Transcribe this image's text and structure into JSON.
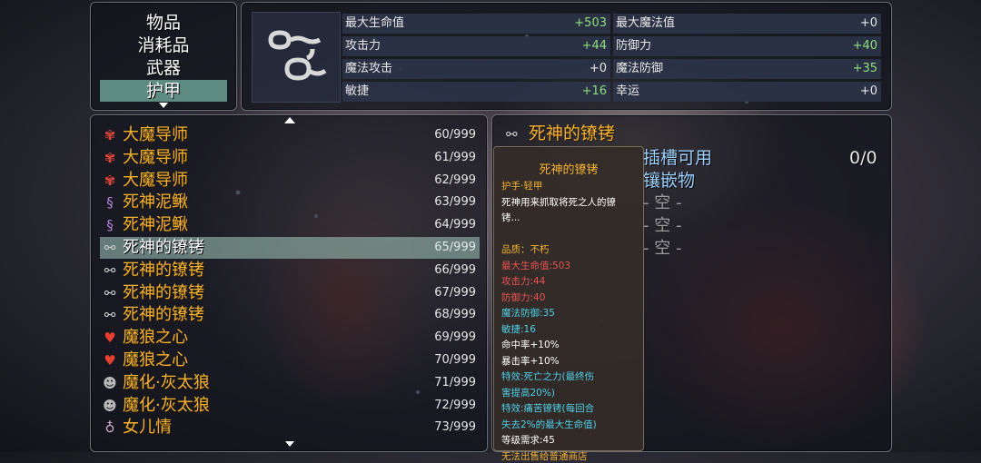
{
  "colors": {
    "gold": "#f2b233",
    "green": "#8fe07c",
    "cyan": "#4fd0e8",
    "red": "#e85454",
    "selected": "#5d8b82"
  },
  "categories": [
    {
      "label": "物品"
    },
    {
      "label": "消耗品"
    },
    {
      "label": "武器"
    },
    {
      "label": "护甲",
      "selected": true
    }
  ],
  "item_image_icon": "shackles-icon",
  "stats": [
    {
      "label": "最大生命值",
      "value": "+503",
      "color": "green"
    },
    {
      "label": "最大魔法值",
      "value": "+0",
      "color": "white"
    },
    {
      "label": "攻击力",
      "value": "+44",
      "color": "green"
    },
    {
      "label": "防御力",
      "value": "+40",
      "color": "green"
    },
    {
      "label": "魔法攻击",
      "value": "+0",
      "color": "white"
    },
    {
      "label": "魔法防御",
      "value": "+35",
      "color": "green"
    },
    {
      "label": "敏捷",
      "value": "+16",
      "color": "green"
    },
    {
      "label": "幸运",
      "value": "+0",
      "color": "white"
    }
  ],
  "items": [
    {
      "icon": "butterfly-icon",
      "name": "大魔导师",
      "count": "60/999"
    },
    {
      "icon": "butterfly-icon",
      "name": "大魔导师",
      "count": "61/999"
    },
    {
      "icon": "butterfly-icon",
      "name": "大魔导师",
      "count": "62/999"
    },
    {
      "icon": "eel-icon",
      "name": "死神泥鳅",
      "count": "63/999"
    },
    {
      "icon": "eel-icon",
      "name": "死神泥鳅",
      "count": "64/999"
    },
    {
      "icon": "shackles-icon",
      "name": "死神的镣铐",
      "count": "65/999",
      "selected": true
    },
    {
      "icon": "shackles-icon",
      "name": "死神的镣铐",
      "count": "66/999"
    },
    {
      "icon": "shackles-icon",
      "name": "死神的镣铐",
      "count": "67/999"
    },
    {
      "icon": "shackles-icon",
      "name": "死神的镣铐",
      "count": "68/999"
    },
    {
      "icon": "demon-heart-icon",
      "name": "魔狼之心",
      "count": "69/999"
    },
    {
      "icon": "demon-heart-icon",
      "name": "魔狼之心",
      "count": "70/999"
    },
    {
      "icon": "wolf-head-icon",
      "name": "魔化·灰太狼",
      "count": "71/999"
    },
    {
      "icon": "wolf-head-icon",
      "name": "魔化·灰太狼",
      "count": "72/999"
    },
    {
      "icon": "necklace-icon",
      "name": "女儿情",
      "count": "73/999"
    }
  ],
  "detail": {
    "title": "死神的镣铐",
    "slots_label": "插槽可用",
    "slots_value": "0/0",
    "inlay_label": "镶嵌物",
    "empty_slot": "- 空 -",
    "empty_count": 3
  },
  "tooltip": {
    "title": "死神的镣铐",
    "lines": [
      {
        "text": "护手·轻甲",
        "color": "gold"
      },
      {
        "text": "死神用来抓取将死之人的镣",
        "color": "white"
      },
      {
        "text": "铐...",
        "color": "white"
      },
      {
        "text": "",
        "color": "white"
      },
      {
        "text": "品质：不朽",
        "color": "gold"
      },
      {
        "text": "最大生命值:503",
        "color": "red"
      },
      {
        "text": "攻击力:44",
        "color": "red"
      },
      {
        "text": "防御力:40",
        "color": "red"
      },
      {
        "text": "魔法防御:35",
        "color": "cyan"
      },
      {
        "text": "敏捷:16",
        "color": "cyan"
      },
      {
        "text": "命中率+10%",
        "color": "white"
      },
      {
        "text": "暴击率+10%",
        "color": "white"
      },
      {
        "text": "特效:死亡之力(最终伤",
        "color": "cyan"
      },
      {
        "text": "害提高20%)",
        "color": "cyan"
      },
      {
        "text": "特效:痛苦镣铐(每回合",
        "color": "cyan"
      },
      {
        "text": "失去2%的最大生命值)",
        "color": "cyan"
      },
      {
        "text": "等级需求:45",
        "color": "white"
      },
      {
        "text": "无法出售给普通商店",
        "color": "gold"
      }
    ]
  }
}
